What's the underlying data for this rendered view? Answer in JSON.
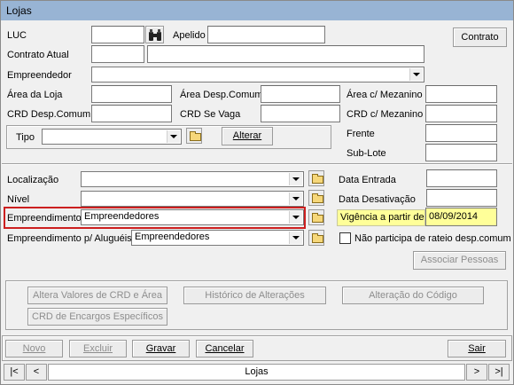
{
  "window": {
    "title": "Lojas"
  },
  "form": {
    "luc_label": "LUC",
    "apelido_label": "Apelido",
    "contrato_button": "Contrato",
    "contrato_atual_label": "Contrato Atual",
    "empreendedor_label": "Empreendedor",
    "area_loja_label": "Área da Loja",
    "area_desp_comum_label": "Área Desp.Comum",
    "area_mezanino_label": "Área c/ Mezanino",
    "crd_desp_comum_label": "CRD Desp.Comum",
    "crd_se_vaga_label": "CRD Se Vaga",
    "crd_mezanino_label": "CRD c/ Mezanino",
    "tipo_label": "Tipo",
    "alterar_button": "Alterar",
    "frente_label": "Frente",
    "sub_lote_label": "Sub-Lote",
    "localizacao_label": "Localização",
    "nivel_label": "Nível",
    "empreendimento_label": "Empreendimento",
    "empreendimento_value": "Empreendedores",
    "emp_alugueis_label": "Empreendimento p/ Aluguéis",
    "emp_alugueis_value": "Empreendedores",
    "data_entrada_label": "Data Entrada",
    "data_desativacao_label": "Data Desativação",
    "vigencia_label": "Vigência a partir de",
    "vigencia_value": "08/09/2014",
    "nao_participa_label": "Não participa de rateio desp.comum",
    "associar_button": "Associar Pessoas"
  },
  "actions": {
    "altera_valores": "Altera Valores de CRD e Área",
    "historico": "Histórico de Alterações",
    "alteracao_codigo": "Alteração do Código",
    "crd_encargos": "CRD de Encargos Específicos"
  },
  "toolbar": {
    "novo": "Novo",
    "excluir": "Excluir",
    "gravar": "Gravar",
    "cancelar": "Cancelar",
    "sair": "Sair"
  },
  "navigator": {
    "first": "|<",
    "prev": "<",
    "caption": "Lojas",
    "next": ">",
    "last": ">|"
  },
  "colors": {
    "highlight_border": "#cc1f1f",
    "vigencia_background": "#ffff99",
    "title_bar": "#98b4d4"
  }
}
